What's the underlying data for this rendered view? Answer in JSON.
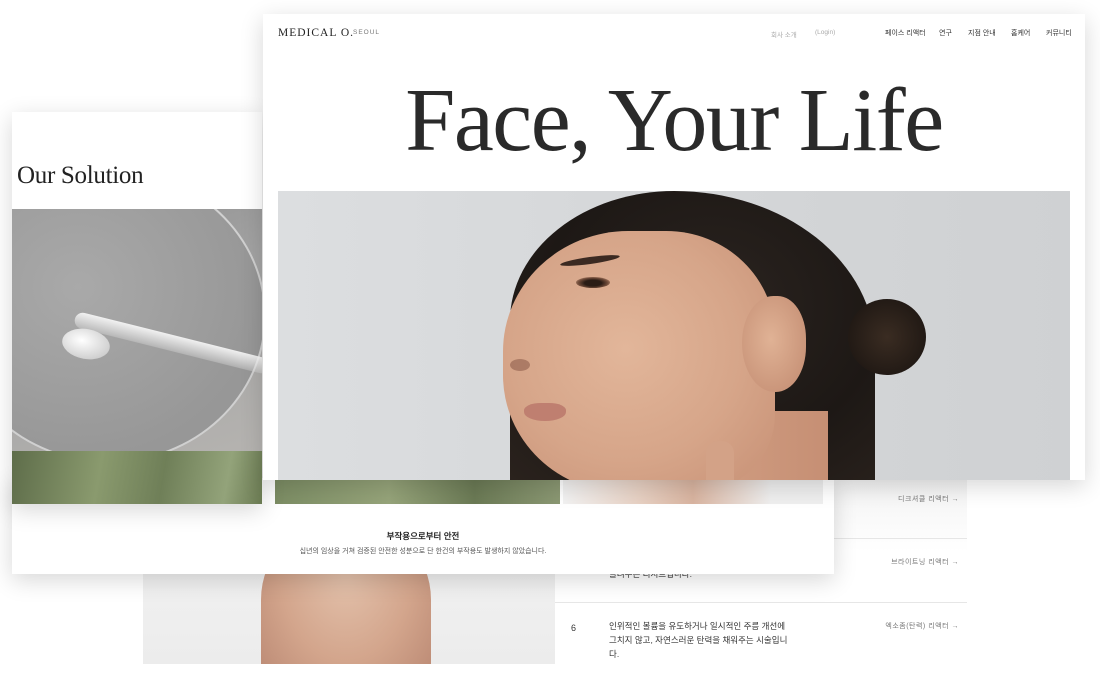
{
  "main": {
    "logo": "MEDICAL O.",
    "logo_sub": "SEOUL",
    "util_links": [
      "회사 소개",
      "(Login)"
    ],
    "nav": [
      "페이스 리액터",
      "연구",
      "지점 안내",
      "홈케어",
      "커뮤니티"
    ],
    "hero_title": "Face, Your Life"
  },
  "solution_panel": {
    "title": "Our Solution"
  },
  "safety_card": {
    "title": "부작용으로부터 안전",
    "description": "십년의 임상을 거쳐 검증된 안전한 성분으로 단 한건의 부작용도 발생하지 않았습니다."
  },
  "treatment_list": {
    "items": [
      {
        "link": "디크셔클 리액터",
        "arrow": "→"
      },
      {
        "text": "올려주는 디저트입니다.",
        "link": "브라이트닝 리액터",
        "arrow": "→"
      },
      {
        "number": "6",
        "text": "인위적인 볼륨을 유도하거나 일시적인 주름 개선에 그치지 않고, 자연스러운 탄력을 채워주는 시술입니다.",
        "link": "엑소좀(탄력) 리액터",
        "arrow": "→"
      }
    ]
  },
  "colors": {
    "text_dark": "#222222",
    "muted": "#aaaaaa",
    "leaf_green": "#7c8d64"
  }
}
